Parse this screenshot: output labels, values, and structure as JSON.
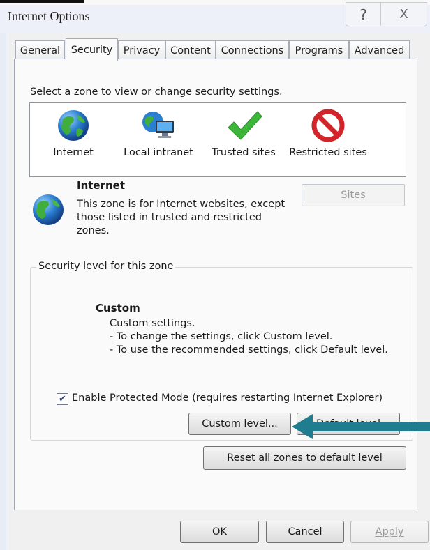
{
  "window": {
    "title": "Internet Options",
    "help_glyph": "?",
    "close_glyph": "X"
  },
  "tabs": [
    "General",
    "Security",
    "Privacy",
    "Content",
    "Connections",
    "Programs",
    "Advanced"
  ],
  "security": {
    "prompt": "Select a zone to view or change security settings.",
    "zones": [
      {
        "name": "Internet",
        "icon": "globe-icon"
      },
      {
        "name": "Local intranet",
        "icon": "intranet-icon"
      },
      {
        "name": "Trusted sites",
        "icon": "checkmark-icon"
      },
      {
        "name": "Restricted sites",
        "icon": "restricted-icon"
      }
    ],
    "selected_zone": {
      "title": "Internet",
      "description": "This zone is for Internet websites, except those listed in trusted and restricted zones."
    },
    "sites_label": "Sites",
    "level_group_label": "Security level for this zone",
    "level": {
      "title": "Custom",
      "text": "Custom settings.\n- To change the settings, click Custom level.\n- To use the recommended settings, click Default level."
    },
    "protected_mode_label": "Enable Protected Mode (requires restarting Internet Explorer)",
    "protected_mode_checked": true,
    "custom_level_label": "Custom level...",
    "default_level_label": "Default level",
    "reset_label": "Reset all zones to default level"
  },
  "footer": {
    "ok": "OK",
    "cancel": "Cancel",
    "apply": "Apply"
  },
  "colors": {
    "annotation_arrow": "#1f7d8f"
  }
}
